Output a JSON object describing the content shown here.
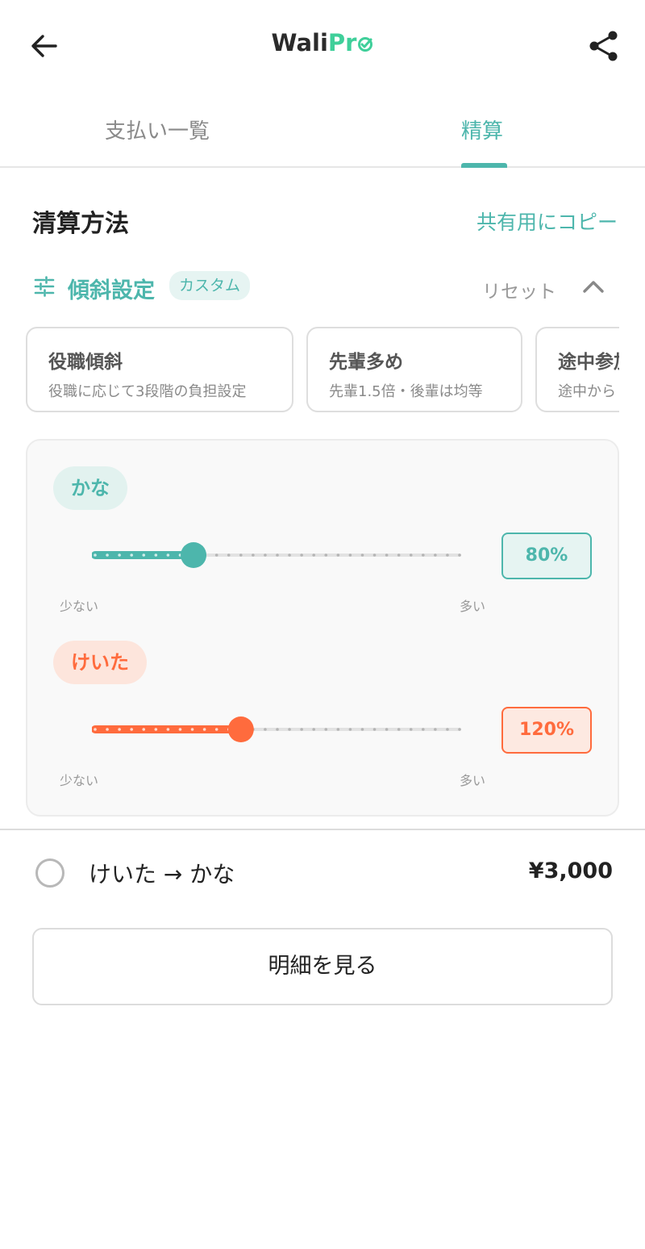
{
  "header": {
    "logo_main": "Wali",
    "logo_accent": "Pr"
  },
  "tabs": [
    {
      "label": "支払い一覧",
      "active": false
    },
    {
      "label": "精算",
      "active": true
    }
  ],
  "section": {
    "title": "清算方法",
    "copy_label": "共有用にコピー"
  },
  "gradient": {
    "title": "傾斜設定",
    "badge": "カスタム",
    "reset_label": "リセット"
  },
  "presets": [
    {
      "title": "役職傾斜",
      "desc": "役職に応じて3段階の負担設定"
    },
    {
      "title": "先輩多め",
      "desc": "先輩1.5倍・後輩は均等"
    },
    {
      "title": "途中参加",
      "desc": "途中から"
    }
  ],
  "members": [
    {
      "name": "かな",
      "percent_label": "80%",
      "slider_fraction": 0.27,
      "color": "#4db6ac",
      "scale_low": "少ない",
      "scale_high": "多い"
    },
    {
      "name": "けいた",
      "percent_label": "120%",
      "slider_fraction": 0.4,
      "color": "#ff6b3d",
      "scale_low": "少ない",
      "scale_high": "多い"
    }
  ],
  "settlement": {
    "text": "けいた → かな",
    "amount": "¥3,000"
  },
  "detail_button": "明細を見る",
  "colors": {
    "accent": "#4db6ac",
    "secondary": "#ff6b3d",
    "logo_green": "#3fcf9a"
  }
}
